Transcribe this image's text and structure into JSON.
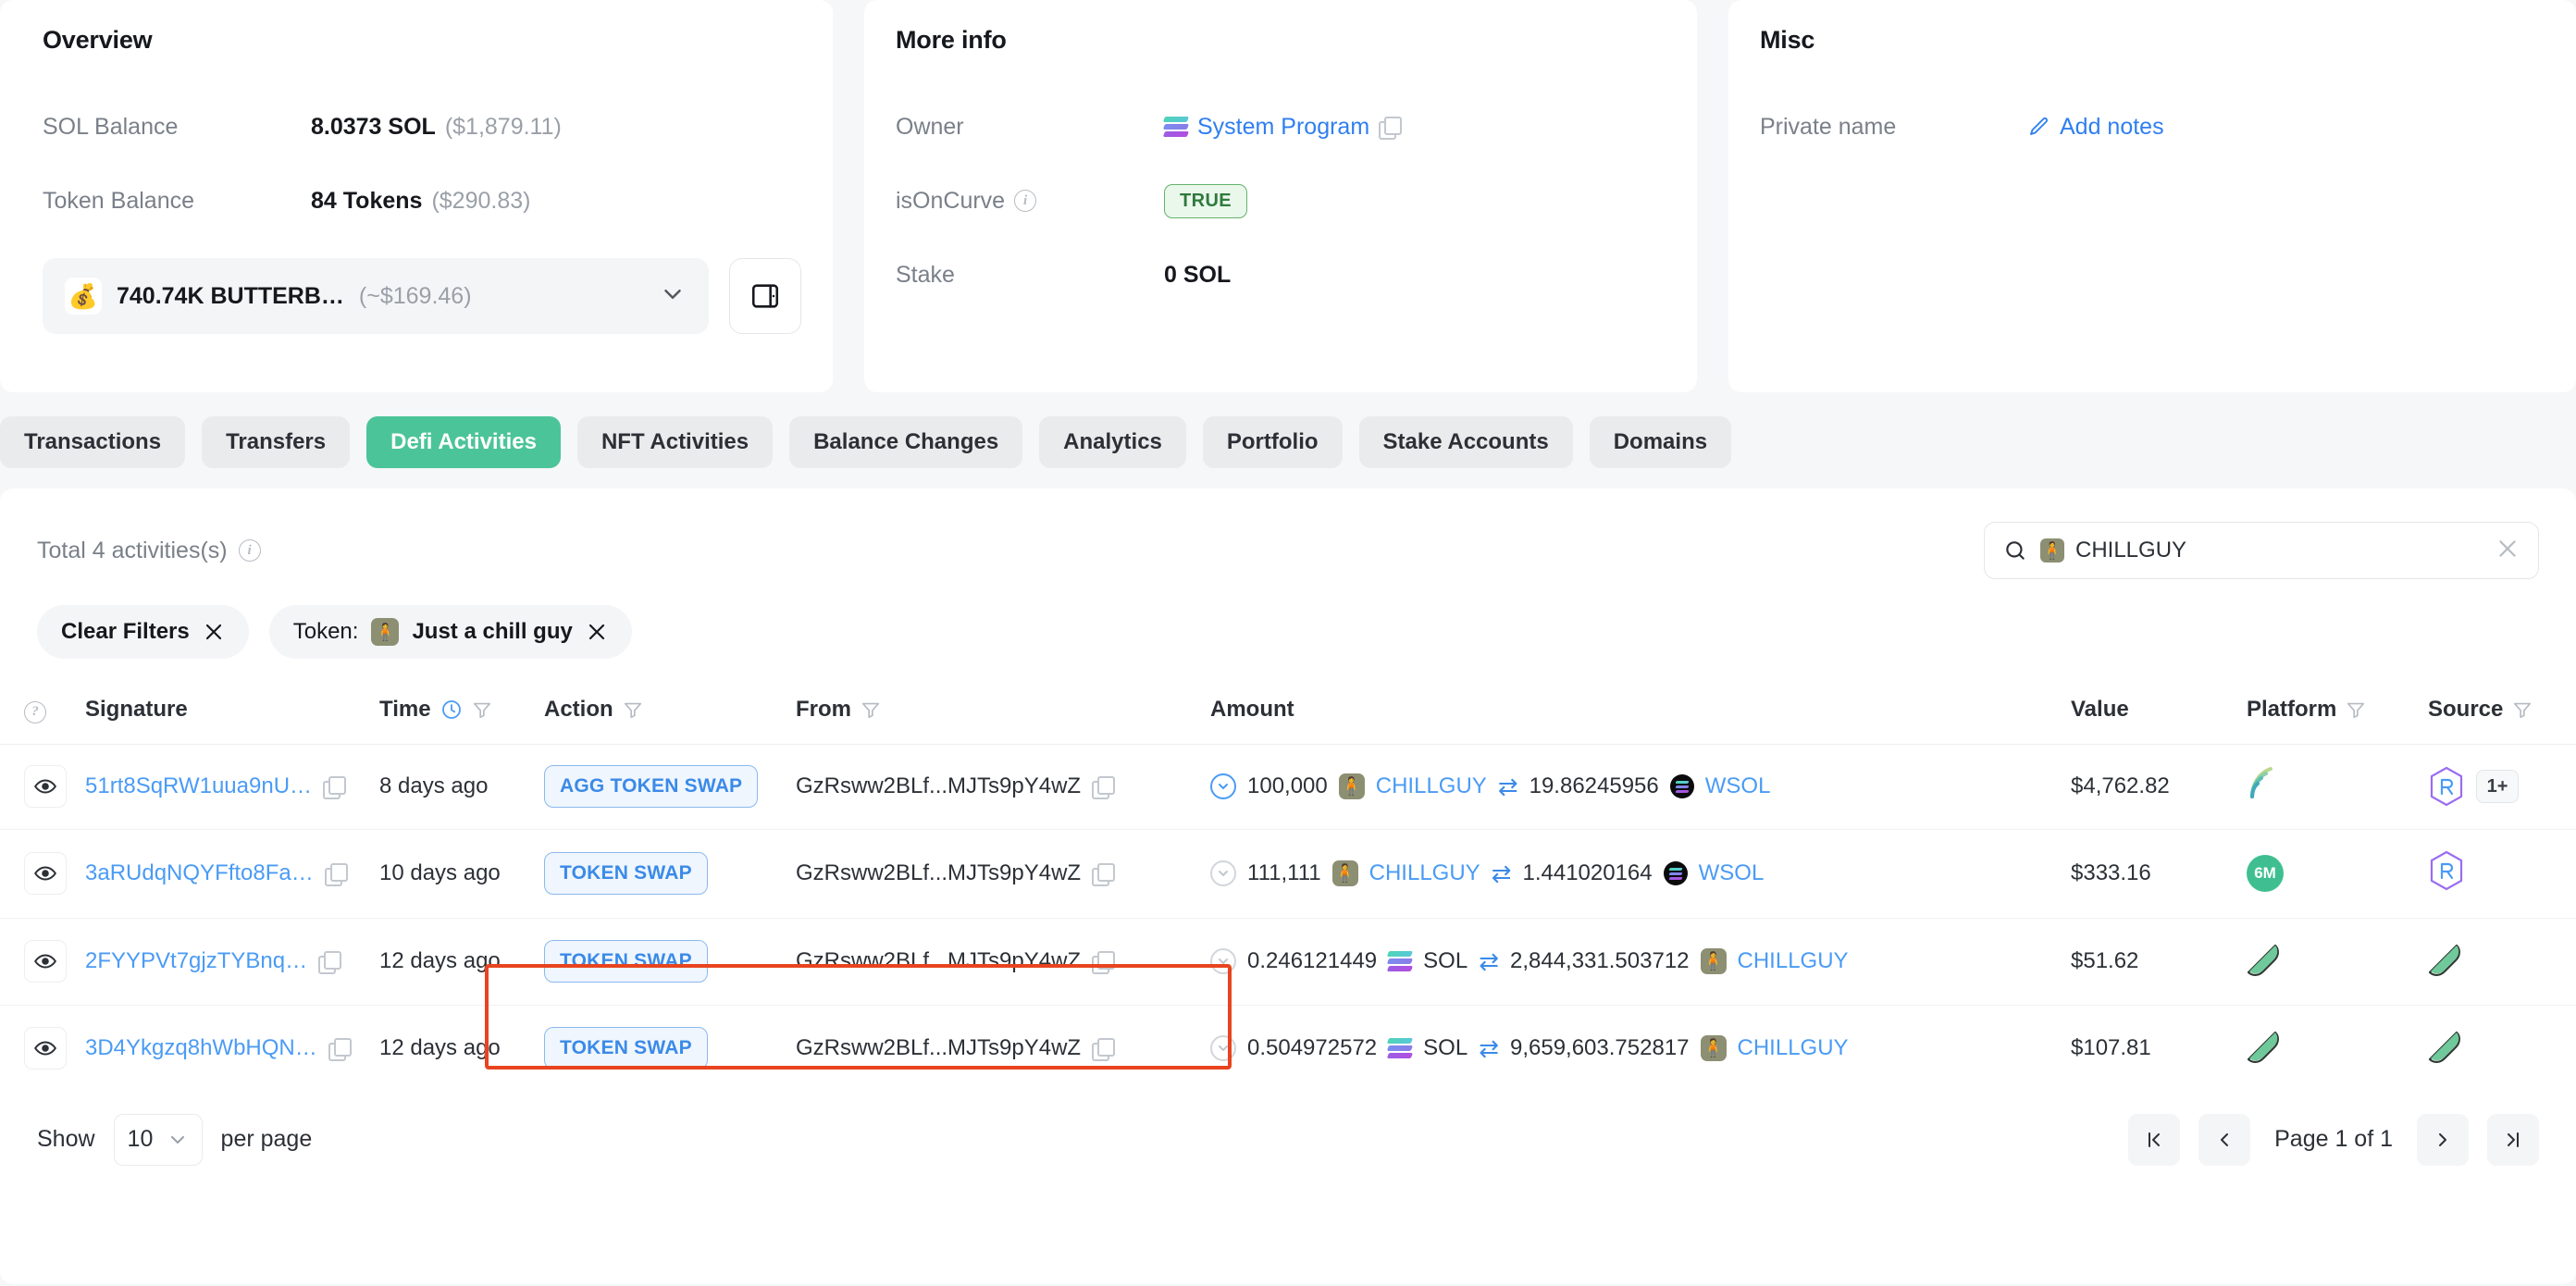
{
  "overview": {
    "title": "Overview",
    "rows": [
      {
        "label": "SOL Balance",
        "value_strong": "8.0373 SOL",
        "value_muted": "($1,879.11)"
      },
      {
        "label": "Token Balance",
        "value_strong": "84 Tokens",
        "value_muted": "($290.83)"
      }
    ],
    "token_select": {
      "icon": "money-bag-icon",
      "emoji": "💰",
      "name": "740.74K BUTTERB…",
      "usd": "(~$169.46)",
      "chevron": "chevron-down-icon"
    },
    "wallet_button_icon": "wallet-icon"
  },
  "more_info": {
    "title": "More info",
    "owner": {
      "label": "Owner",
      "value": "System Program",
      "icon": "solana-logo-icon",
      "copy": "copy-icon"
    },
    "is_on_curve": {
      "label": "isOnCurve",
      "info": "info-icon",
      "value": "TRUE"
    },
    "stake": {
      "label": "Stake",
      "value": "0 SOL"
    }
  },
  "misc": {
    "title": "Misc",
    "private_name": {
      "label": "Private name",
      "action": "Add notes",
      "icon": "pencil-icon"
    }
  },
  "tabs": [
    {
      "label": "Transactions",
      "active": false
    },
    {
      "label": "Transfers",
      "active": false
    },
    {
      "label": "Defi Activities",
      "active": true
    },
    {
      "label": "NFT Activities",
      "active": false
    },
    {
      "label": "Balance Changes",
      "active": false
    },
    {
      "label": "Analytics",
      "active": false
    },
    {
      "label": "Portfolio",
      "active": false
    },
    {
      "label": "Stake Accounts",
      "active": false
    },
    {
      "label": "Domains",
      "active": false
    }
  ],
  "panel": {
    "total_text": "Total 4 activities(s)",
    "search": {
      "icon": "search-icon",
      "value": "CHILLGUY",
      "token_emoji": "🧍",
      "clear": "close-icon"
    },
    "chips": [
      {
        "prefix": "",
        "label": "Clear Filters",
        "has_avatar": false,
        "close": "close-icon"
      },
      {
        "prefix": "Token:",
        "label": "Just a chill guy",
        "has_avatar": true,
        "close": "close-icon"
      }
    ],
    "columns": [
      {
        "key": "eye",
        "label": "",
        "help": true,
        "filter": false,
        "clock": false
      },
      {
        "key": "sig",
        "label": "Signature",
        "help": false,
        "filter": false,
        "clock": false
      },
      {
        "key": "time",
        "label": "Time",
        "help": false,
        "filter": true,
        "clock": true
      },
      {
        "key": "action",
        "label": "Action",
        "help": false,
        "filter": true,
        "clock": false
      },
      {
        "key": "from",
        "label": "From",
        "help": false,
        "filter": true,
        "clock": false
      },
      {
        "key": "amount",
        "label": "Amount",
        "help": false,
        "filter": false,
        "clock": false
      },
      {
        "key": "value",
        "label": "Value",
        "help": false,
        "filter": false,
        "clock": false
      },
      {
        "key": "platform",
        "label": "Platform",
        "help": false,
        "filter": true,
        "clock": false
      },
      {
        "key": "source",
        "label": "Source",
        "help": false,
        "filter": true,
        "clock": false
      }
    ],
    "rows": [
      {
        "signature": "51rt8SqRW1uua9nU…",
        "time": "8 days ago",
        "action": "AGG TOKEN SWAP",
        "from": "GzRsww2BLf...MJTs9pY4wZ",
        "amount_in": "100,000",
        "token_in": "CHILLGUY",
        "token_in_icon": "chillguy-avatar",
        "amount_out": "19.86245956",
        "token_out": "WSOL",
        "token_out_icon": "wsol-icon",
        "value": "$4,762.82",
        "platform": "meteora-icon",
        "source": "raydium-icon",
        "source_extra": "1+",
        "chevron_blue": true
      },
      {
        "signature": "3aRUdqNQYFfto8Fa…",
        "time": "10 days ago",
        "action": "TOKEN SWAP",
        "from": "GzRsww2BLf...MJTs9pY4wZ",
        "amount_in": "111,111",
        "token_in": "CHILLGUY",
        "token_in_icon": "chillguy-avatar",
        "amount_out": "1.441020164",
        "token_out": "WSOL",
        "token_out_icon": "wsol-icon",
        "value": "$333.16",
        "platform": "6m-icon",
        "source": "raydium-icon",
        "source_extra": "",
        "chevron_blue": false
      },
      {
        "signature": "2FYYPVt7gjzTYBnq…",
        "time": "12 days ago",
        "action": "TOKEN SWAP",
        "from": "GzRsww2BLf...MJTs9pY4wZ",
        "amount_in": "0.246121449",
        "token_in": "SOL",
        "token_in_icon": "solana-logo-icon",
        "amount_out": "2,844,331.503712",
        "token_out": "CHILLGUY",
        "token_out_icon": "chillguy-avatar",
        "value": "$51.62",
        "platform": "orca-icon",
        "source": "orca-icon",
        "source_extra": "",
        "chevron_blue": false
      },
      {
        "signature": "3D4Ykgzq8hWbHQN…",
        "time": "12 days ago",
        "action": "TOKEN SWAP",
        "from": "GzRsww2BLf...MJTs9pY4wZ",
        "amount_in": "0.504972572",
        "token_in": "SOL",
        "token_in_icon": "solana-logo-icon",
        "amount_out": "9,659,603.752817",
        "token_out": "CHILLGUY",
        "token_out_icon": "chillguy-avatar",
        "value": "$107.81",
        "platform": "orca-icon",
        "source": "orca-icon",
        "source_extra": "",
        "chevron_blue": false
      }
    ],
    "footer": {
      "show_label": "Show",
      "per_page_value": "10",
      "per_page_label": "per page",
      "first": "first-page-icon",
      "prev": "prev-page-icon",
      "page_text": "Page 1 of 1",
      "next": "next-page-icon",
      "last": "last-page-icon"
    }
  },
  "colors": {
    "accent_green": "#4cc49a",
    "link_blue": "#4a9bf5",
    "highlight_red": "#e8441f",
    "badge_green_border": "#63b36a"
  }
}
